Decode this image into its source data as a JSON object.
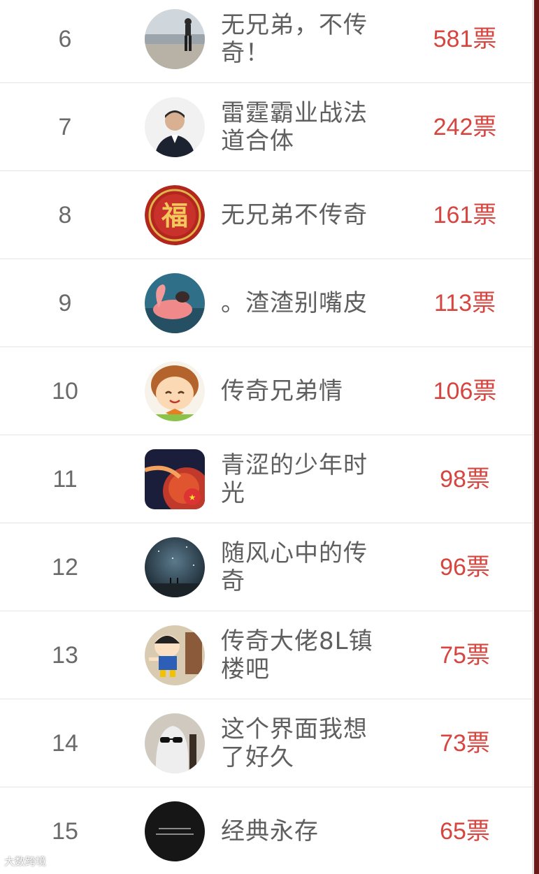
{
  "list": {
    "vote_suffix": "票",
    "rows": [
      {
        "rank": "6",
        "name": "无兄弟，不传奇！",
        "votes": "581票",
        "avatar_icon": "beach-figure-avatar-icon"
      },
      {
        "rank": "7",
        "name": "雷霆霸业战法道合体",
        "votes": "242票",
        "avatar_icon": "man-portrait-avatar-icon"
      },
      {
        "rank": "8",
        "name": "无兄弟不传奇",
        "votes": "161票",
        "avatar_icon": "fu-character-avatar-icon"
      },
      {
        "rank": "9",
        "name": "。渣渣别嘴皮",
        "votes": "113票",
        "avatar_icon": "flamingo-float-avatar-icon"
      },
      {
        "rank": "10",
        "name": "传奇兄弟情",
        "votes": "106票",
        "avatar_icon": "cartoon-boy-avatar-icon"
      },
      {
        "rank": "11",
        "name": "青涩的少年时光",
        "votes": "98票",
        "avatar_icon": "planet-flag-avatar-icon"
      },
      {
        "rank": "12",
        "name": "随风心中的传奇",
        "votes": "96票",
        "avatar_icon": "night-sky-avatar-icon"
      },
      {
        "rank": "13",
        "name": "传奇大佬8L镇楼吧",
        "votes": "75票",
        "avatar_icon": "crayon-shin-chan-avatar-icon"
      },
      {
        "rank": "14",
        "name": "这个界面我想了好久",
        "votes": "73票",
        "avatar_icon": "sunglasses-ghost-avatar-icon"
      },
      {
        "rank": "15",
        "name": "经典永存",
        "votes": "65票",
        "avatar_icon": "dark-text-avatar-icon"
      }
    ]
  },
  "colors": {
    "rank_text": "#6a6a6a",
    "name_text": "#5f5f5f",
    "vote_text": "#d6453f",
    "divider": "#e4e4e4",
    "right_border": "#6b1a1a"
  },
  "watermark": "大数跨境"
}
